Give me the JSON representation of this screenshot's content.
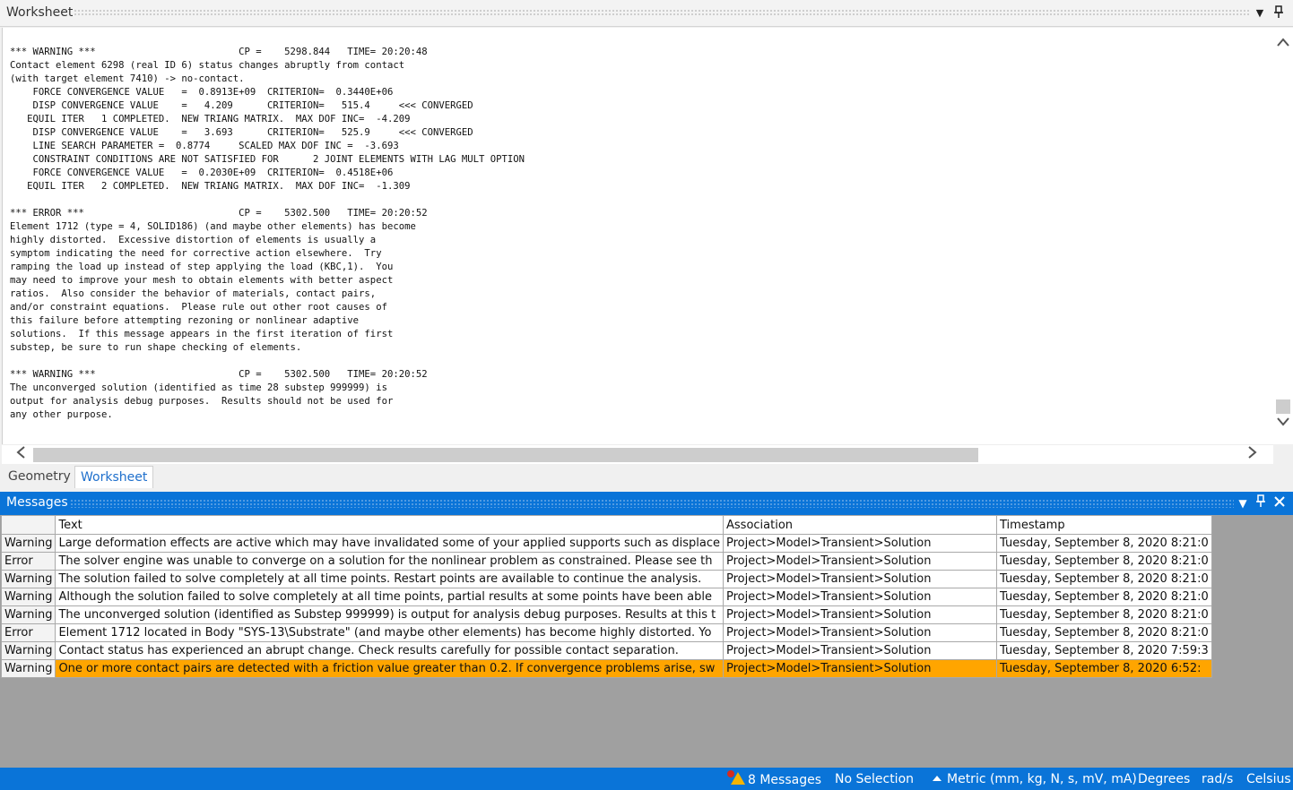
{
  "worksheet": {
    "title": "Worksheet",
    "log": "*** WARNING ***                         CP =    5298.844   TIME= 20:20:48\nContact element 6298 (real ID 6) status changes abruptly from contact\n(with target element 7410) -> no-contact.\n    FORCE CONVERGENCE VALUE   =  0.8913E+09  CRITERION=  0.3440E+06\n    DISP CONVERGENCE VALUE    =   4.209      CRITERION=   515.4     <<< CONVERGED\n   EQUIL ITER   1 COMPLETED.  NEW TRIANG MATRIX.  MAX DOF INC=  -4.209\n    DISP CONVERGENCE VALUE    =   3.693      CRITERION=   525.9     <<< CONVERGED\n    LINE SEARCH PARAMETER =  0.8774     SCALED MAX DOF INC =  -3.693\n    CONSTRAINT CONDITIONS ARE NOT SATISFIED FOR      2 JOINT ELEMENTS WITH LAG MULT OPTION\n    FORCE CONVERGENCE VALUE   =  0.2030E+09  CRITERION=  0.4518E+06\n   EQUIL ITER   2 COMPLETED.  NEW TRIANG MATRIX.  MAX DOF INC=  -1.309\n\n*** ERROR ***                           CP =    5302.500   TIME= 20:20:52\nElement 1712 (type = 4, SOLID186) (and maybe other elements) has become\nhighly distorted.  Excessive distortion of elements is usually a\nsymptom indicating the need for corrective action elsewhere.  Try\nramping the load up instead of step applying the load (KBC,1).  You\nmay need to improve your mesh to obtain elements with better aspect\nratios.  Also consider the behavior of materials, contact pairs,\nand/or constraint equations.  Please rule out other root causes of\nthis failure before attempting rezoning or nonlinear adaptive\nsolutions.  If this message appears in the first iteration of first\nsubstep, be sure to run shape checking of elements.\n\n*** WARNING ***                         CP =    5302.500   TIME= 20:20:52\nThe unconverged solution (identified as time 28 substep 999999) is\noutput for analysis debug purposes.  Results should not be used for\nany other purpose."
  },
  "tabs": [
    {
      "label": "Geometry"
    },
    {
      "label": "Worksheet"
    }
  ],
  "messages": {
    "title": "Messages",
    "columns": [
      "Text",
      "Association",
      "Timestamp"
    ],
    "rows": [
      {
        "severity": "Warning",
        "text": "Large deformation effects are active which may have invalidated some of your applied supports such as displace",
        "association": "Project>Model>Transient>Solution",
        "timestamp": "Tuesday, September 8, 2020 8:21:0"
      },
      {
        "severity": "Error",
        "text": "The solver engine was unable to converge on a solution for the nonlinear problem as constrained.  Please see th",
        "association": "Project>Model>Transient>Solution",
        "timestamp": "Tuesday, September 8, 2020 8:21:0"
      },
      {
        "severity": "Warning",
        "text": "The solution failed to solve completely at all time points. Restart points are available to continue the analysis.",
        "association": "Project>Model>Transient>Solution",
        "timestamp": "Tuesday, September 8, 2020 8:21:0"
      },
      {
        "severity": "Warning",
        "text": "Although the solution failed to solve completely at all time points, partial results at some points have been able",
        "association": "Project>Model>Transient>Solution",
        "timestamp": "Tuesday, September 8, 2020 8:21:0"
      },
      {
        "severity": "Warning",
        "text": "The unconverged solution (identified as Substep 999999) is output for analysis debug purposes. Results at this t",
        "association": "Project>Model>Transient>Solution",
        "timestamp": "Tuesday, September 8, 2020 8:21:0"
      },
      {
        "severity": "Error",
        "text": "Element 1712 located in Body \"SYS-13\\Substrate\" (and maybe other elements) has become highly distorted.  Yo",
        "association": "Project>Model>Transient>Solution",
        "timestamp": "Tuesday, September 8, 2020 8:21:0"
      },
      {
        "severity": "Warning",
        "text": "Contact status has experienced an abrupt change.  Check results carefully for possible contact separation.",
        "association": "Project>Model>Transient>Solution",
        "timestamp": "Tuesday, September 8, 2020 7:59:3"
      },
      {
        "severity": "Warning",
        "text": " One or more contact pairs are detected with a friction value greater than 0.2. If convergence problems arise, sw",
        "association": "Project>Model>Transient>Solution",
        "timestamp": "Tuesday, September 8, 2020 6:52:"
      }
    ]
  },
  "status": {
    "messages": "8 Messages",
    "selection": "No Selection",
    "units": "Metric (mm, kg, N, s, mV, mA)",
    "angle": "Degrees",
    "rotational": "rad/s",
    "temperature": "Celsius"
  },
  "colors": {
    "accent": "#0a74d8",
    "selected_row": "#ffa500"
  }
}
